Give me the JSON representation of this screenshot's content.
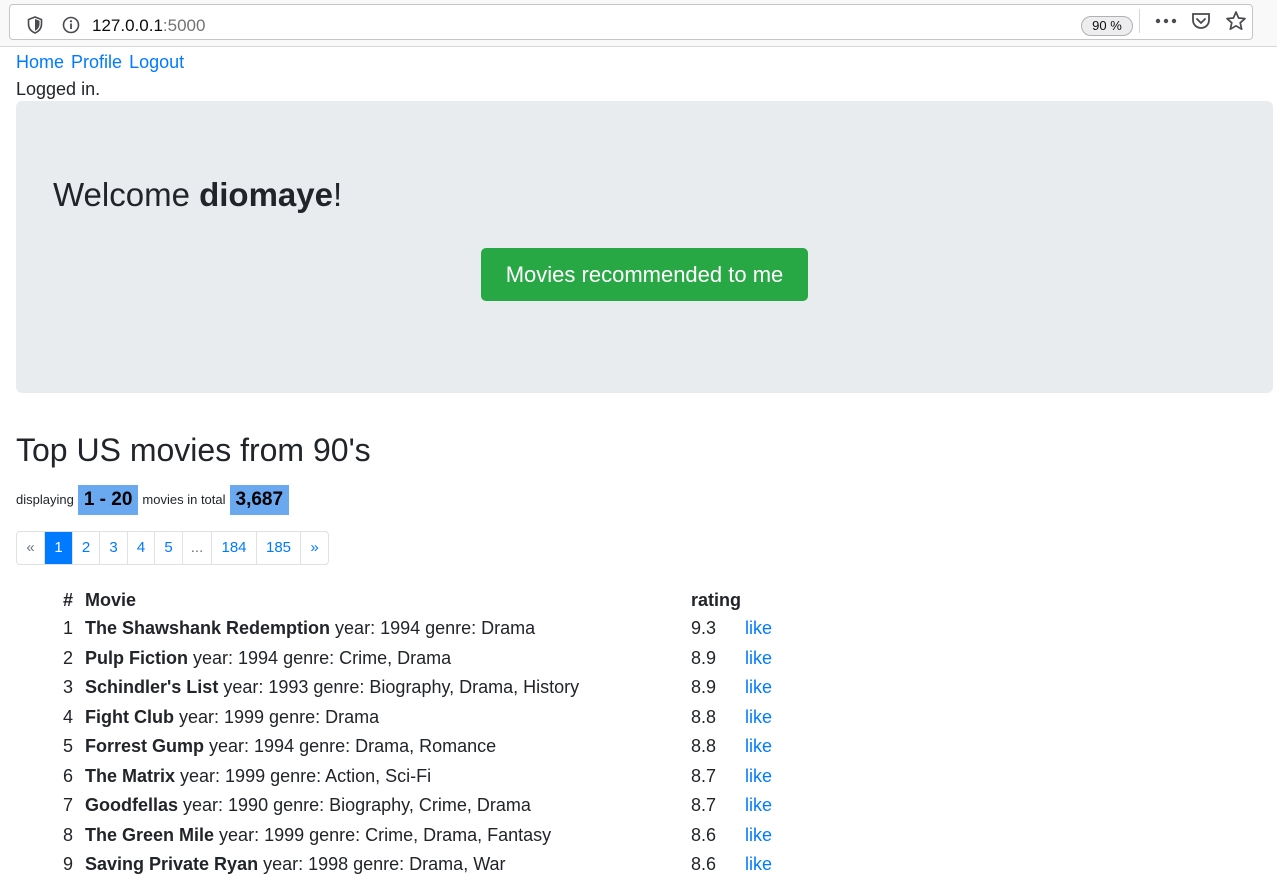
{
  "browser": {
    "url_host": "127.0.0.1",
    "url_port": ":5000",
    "zoom": "90 %"
  },
  "nav": {
    "home": "Home",
    "profile": "Profile",
    "logout": "Logout"
  },
  "status": "Logged in.",
  "jumbotron": {
    "welcome_prefix": "Welcome ",
    "username": "diomaye",
    "welcome_suffix": "!",
    "button": "Movies recommended to me"
  },
  "section": {
    "title": "Top US movies from 90's",
    "displaying_label": "displaying",
    "range": "1 - 20",
    "total_label": "movies in total",
    "total": "3,687"
  },
  "pagination": [
    "«",
    "1",
    "2",
    "3",
    "4",
    "5",
    "...",
    "184",
    "185",
    "»"
  ],
  "pagination_active": "1",
  "table": {
    "headers": {
      "num": "#",
      "movie": "Movie",
      "rating": "rating"
    },
    "rows": [
      {
        "num": "1",
        "title": "The Shawshank Redemption",
        "details": " year: 1994 genre: Drama",
        "rating": "9.3",
        "action": "like"
      },
      {
        "num": "2",
        "title": "Pulp Fiction",
        "details": " year: 1994 genre: Crime, Drama",
        "rating": "8.9",
        "action": "like"
      },
      {
        "num": "3",
        "title": "Schindler's List",
        "details": " year: 1993 genre: Biography, Drama, History",
        "rating": "8.9",
        "action": "like"
      },
      {
        "num": "4",
        "title": "Fight Club",
        "details": " year: 1999 genre: Drama",
        "rating": "8.8",
        "action": "like"
      },
      {
        "num": "5",
        "title": "Forrest Gump",
        "details": " year: 1994 genre: Drama, Romance",
        "rating": "8.8",
        "action": "like"
      },
      {
        "num": "6",
        "title": "The Matrix",
        "details": " year: 1999 genre: Action, Sci-Fi",
        "rating": "8.7",
        "action": "like"
      },
      {
        "num": "7",
        "title": "Goodfellas",
        "details": " year: 1990 genre: Biography, Crime, Drama",
        "rating": "8.7",
        "action": "like"
      },
      {
        "num": "8",
        "title": "The Green Mile",
        "details": " year: 1999 genre: Crime, Drama, Fantasy",
        "rating": "8.6",
        "action": "like"
      },
      {
        "num": "9",
        "title": "Saving Private Ryan",
        "details": " year: 1998 genre: Drama, War",
        "rating": "8.6",
        "action": "like"
      }
    ]
  }
}
